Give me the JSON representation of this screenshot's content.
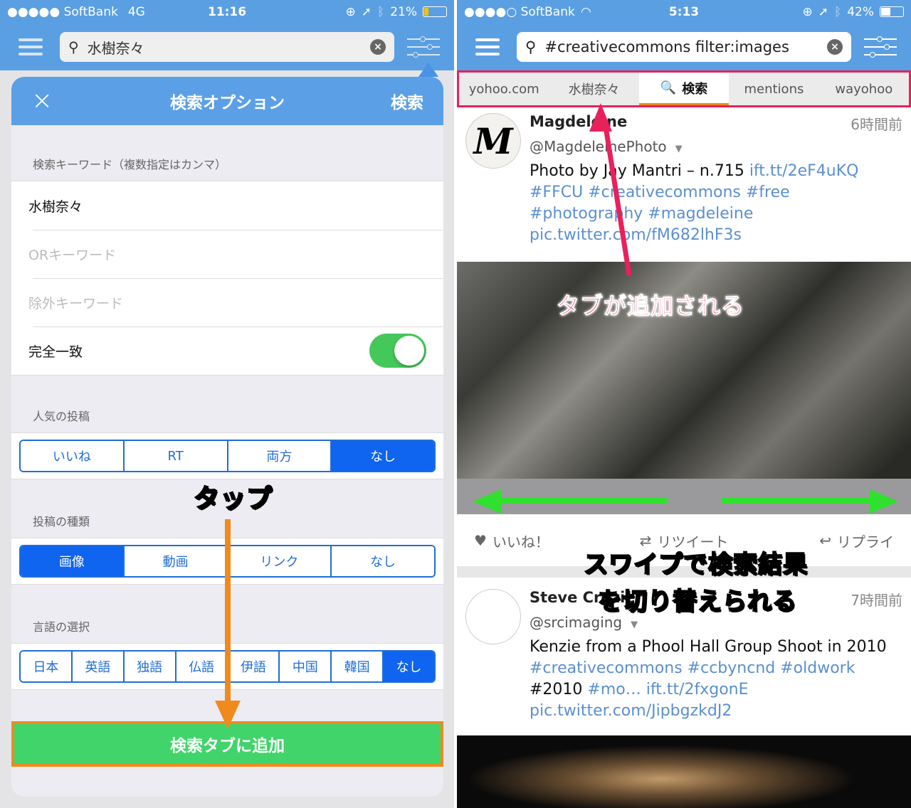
{
  "left": {
    "status": {
      "carrier": "●●●●● SoftBank",
      "network": "4G",
      "time": "11:16",
      "battery": "21%",
      "battery_level": 0.21,
      "battery_color": "#f5c400"
    },
    "search": {
      "value": "水樹奈々",
      "clear": "×"
    },
    "modal": {
      "close": "×",
      "title": "検索オプション",
      "search_button": "検索",
      "keyword_label": "検索キーワード（複数指定はカンマ）",
      "keyword_value": "水樹奈々",
      "or_placeholder": "ORキーワード",
      "exclude_placeholder": "除外キーワード",
      "exact_label": "完全一致",
      "exact_on": true,
      "popular_label": "人気の投稿",
      "popular_options": [
        "いいね",
        "RT",
        "両方",
        "なし"
      ],
      "popular_selected": "なし",
      "type_label": "投稿の種類",
      "type_options": [
        "画像",
        "動画",
        "リンク",
        "なし"
      ],
      "type_selected": "画像",
      "lang_label": "言語の選択",
      "lang_options": [
        "日本",
        "英語",
        "独語",
        "仏語",
        "伊語",
        "中国",
        "韓国",
        "なし"
      ],
      "lang_selected": "なし",
      "add_button": "検索タブに追加"
    },
    "annotation": "タップ"
  },
  "right": {
    "status": {
      "carrier": "●●●●○ SoftBank",
      "wifi": "wifi",
      "time": "5:13",
      "battery": "42%",
      "battery_level": 0.42,
      "battery_color": "#ffffff"
    },
    "search": {
      "value": "#creativecommons filter:images",
      "clear": "×"
    },
    "tabs": [
      {
        "label": "yohoo.com"
      },
      {
        "label": "水樹奈々"
      },
      {
        "label": "検索",
        "icon": "magnifier-icon",
        "active": true
      },
      {
        "label": "mentions"
      },
      {
        "label": "wayohoo"
      }
    ],
    "tweets": [
      {
        "avatar": "M",
        "name": "Magdeleine",
        "handle": "@MagdeleinePhoto",
        "time": "6時間前",
        "text_plain": "Photo by Jay Mantri – n.715 ",
        "text_links": "ift.tt/2eF4uKQ #FFCU #creativecommons #free #photography #magdeleine pic.twitter.com/fM682lhF3s"
      },
      {
        "avatar": "",
        "name": "Steve Crozier",
        "handle": "@srcimaging",
        "time": "7時間前",
        "text_plain": "Kenzie from a Phool Hall Group Shoot in 2010 ",
        "text_links": "#creativecommons #ccbyncnd #oldwork",
        "text_plain2": " #2010 ",
        "text_links2": "#mo… ift.tt/2fxgonE pic.twitter.com/JipbgzkdJ2"
      }
    ],
    "actions": {
      "like": "いいね！",
      "retweet": "リツイート",
      "reply": "リプライ"
    },
    "annotations": {
      "tab_added": "タブが追加される",
      "swipe1": "スワイプで検索結果",
      "swipe2": "を切り替えられる"
    }
  }
}
